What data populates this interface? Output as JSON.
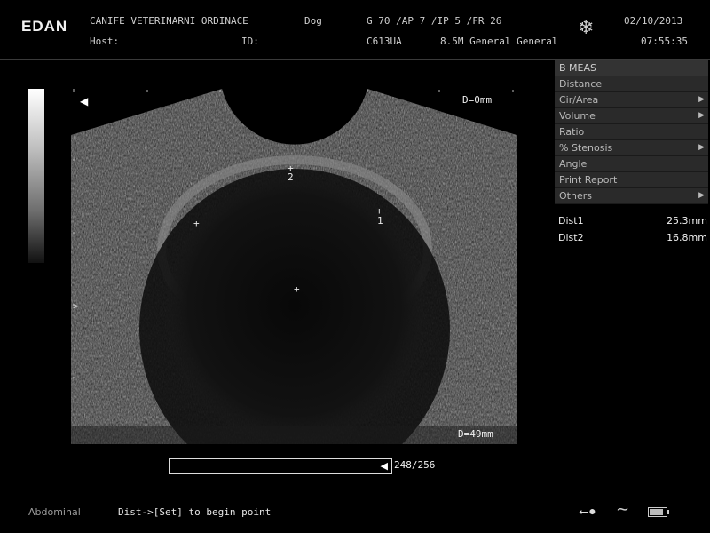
{
  "header": {
    "brand": "EDAN",
    "clinic": "CANIFE VETERINARNI ORDINACE",
    "host_label": "Host:",
    "species": "Dog",
    "id_label": "ID:",
    "params": "G 70 /AP 7 /IP 5 /FR 26",
    "probe": "C613UA",
    "frequency": "8.5M General General",
    "date": "02/10/2013",
    "time": "07:55:35",
    "freeze_icon": "snowflake-icon"
  },
  "image": {
    "depth_top": "D=0mm",
    "depth_bottom": "D=49mm",
    "focus_marker": ">",
    "marker1": "1",
    "marker2": "2"
  },
  "menu": {
    "title": "B MEAS",
    "items": [
      {
        "label": "Distance",
        "submenu": false
      },
      {
        "label": "Cir/Area",
        "submenu": true
      },
      {
        "label": "Volume",
        "submenu": true
      },
      {
        "label": "Ratio",
        "submenu": false
      },
      {
        "label": "% Stenosis",
        "submenu": true
      },
      {
        "label": "Angle",
        "submenu": false
      },
      {
        "label": "Print Report",
        "submenu": false
      },
      {
        "label": "Others",
        "submenu": true
      }
    ]
  },
  "measurements": [
    {
      "label": "Dist1",
      "value": "25.3mm"
    },
    {
      "label": "Dist2",
      "value": "16.8mm"
    }
  ],
  "cine": {
    "count": "248/256",
    "frame": 248,
    "total": 256
  },
  "footer": {
    "preset": "Abdominal",
    "hint": "Dist->[Set] to begin point"
  },
  "status": {
    "usb_icon": "usb-icon",
    "wave_icon": "wave-icon",
    "battery_icon": "battery-icon",
    "battery_level": 0.85
  }
}
